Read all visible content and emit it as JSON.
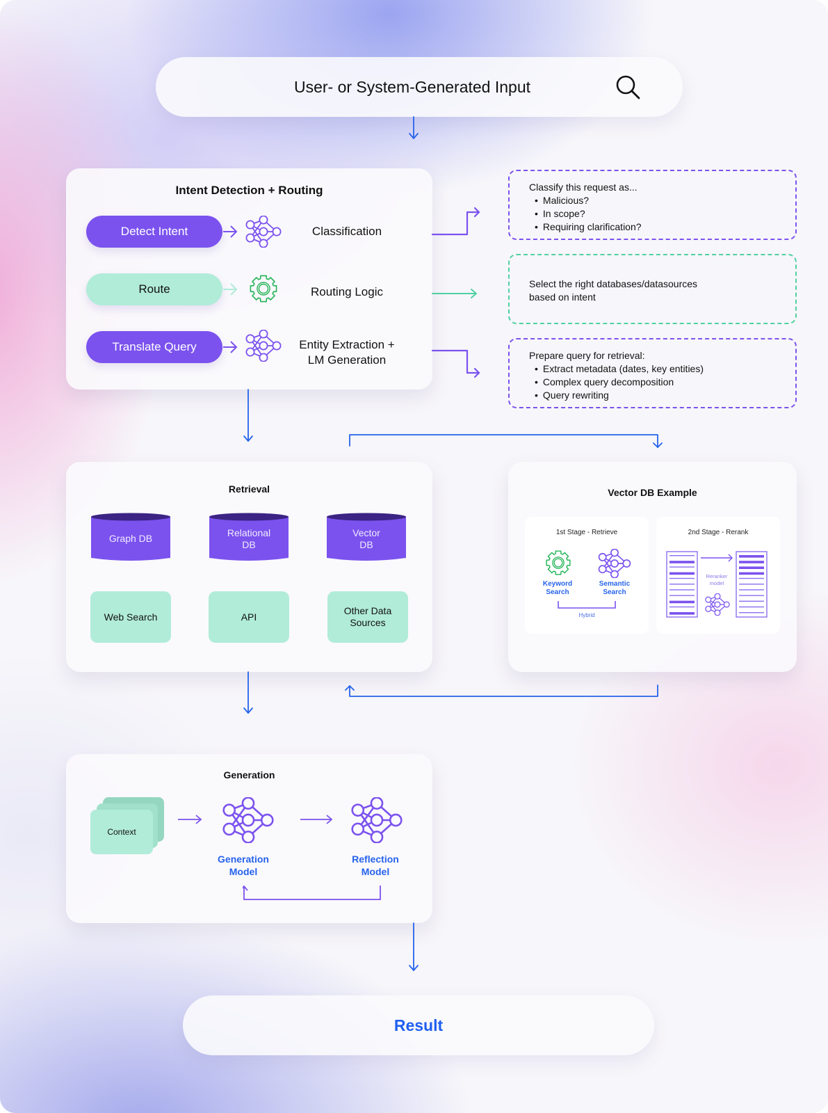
{
  "input_bar": {
    "text": "User- or System-Generated Input",
    "icon": "search-icon"
  },
  "intent": {
    "title": "Intent Detection + Routing",
    "rows": [
      {
        "button": "Detect Intent",
        "icon": "neural-network-icon",
        "label": "Classification",
        "color": "#7b52ee"
      },
      {
        "button": "Route",
        "icon": "gear-icon",
        "label": "Routing Logic",
        "color": "#b1ecd9"
      },
      {
        "button": "Translate Query",
        "icon": "neural-network-icon",
        "label_line1": "Entity Extraction +",
        "label_line2": "LM Generation",
        "color": "#7b52ee"
      }
    ]
  },
  "notes": {
    "classify": {
      "heading": "Classify this request as...",
      "items": [
        "Malicious?",
        "In scope?",
        "Requiring clarification?"
      ]
    },
    "route": {
      "line1": "Select the right databases/datasources",
      "line2": "based on intent"
    },
    "prepare": {
      "heading": "Prepare query for retrieval:",
      "items": [
        "Extract metadata (dates, key entities)",
        "Complex query decomposition",
        "Query rewriting"
      ]
    }
  },
  "retrieval": {
    "title": "Retrieval",
    "databases": [
      {
        "line1": "Graph DB",
        "line2": ""
      },
      {
        "line1": "Relational",
        "line2": "DB"
      },
      {
        "line1": "Vector",
        "line2": "DB"
      }
    ],
    "sources": [
      {
        "line1": "Web Search",
        "line2": ""
      },
      {
        "line1": "API",
        "line2": ""
      },
      {
        "line1": "Other Data",
        "line2": "Sources"
      }
    ]
  },
  "vector_example": {
    "title": "Vector DB Example",
    "stage1": {
      "title": "1st Stage - Retrieve",
      "keyword": {
        "line1": "Keyword",
        "line2": "Search"
      },
      "semantic": {
        "line1": "Semantic",
        "line2": "Search"
      },
      "hybrid": "Hybrid"
    },
    "stage2": {
      "title": "2nd Stage - Rerank",
      "model": {
        "line1": "Reranker",
        "line2": "model"
      }
    }
  },
  "generation": {
    "title": "Generation",
    "context": "Context",
    "gen_model": {
      "line1": "Generation",
      "line2": "Model"
    },
    "reflect_model": {
      "line1": "Reflection",
      "line2": "Model"
    }
  },
  "result": {
    "text": "Result"
  },
  "colors": {
    "purple": "#7b52ee",
    "mint": "#b1ecd9",
    "green_icon": "#22b455",
    "blue_arrow": "#2563eb",
    "dashed_green": "#4fd1a1"
  }
}
